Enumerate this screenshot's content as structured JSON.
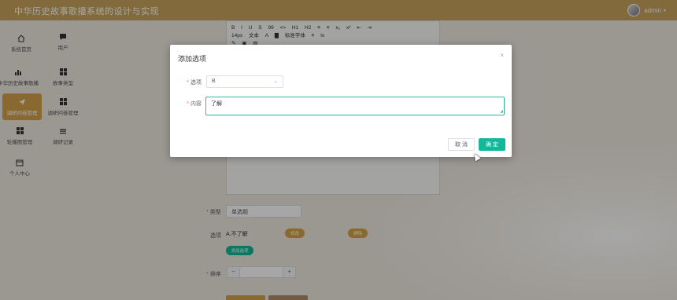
{
  "app": {
    "title": "中华历史故事歌播系统的设计与实现"
  },
  "user": {
    "name": "admin",
    "caret": "▾"
  },
  "sidebar": {
    "items": [
      {
        "label": "系统首页",
        "icon": "home-icon"
      },
      {
        "label": "用户",
        "icon": "chat-icon"
      },
      {
        "label": "中华历史故事歌播",
        "icon": "chart-icon"
      },
      {
        "label": "故事类型",
        "icon": "grid-icon"
      },
      {
        "label": "调研问卷管理",
        "icon": "send-icon",
        "active": true
      },
      {
        "label": "调研问卷管理",
        "icon": "grid-icon"
      },
      {
        "label": "轮播图管理",
        "icon": "grid-icon"
      },
      {
        "label": "调研记录",
        "icon": "list-icon"
      },
      {
        "label": "个人中心",
        "icon": "calendar-icon"
      }
    ]
  },
  "editor": {
    "toolbar_row1": [
      "B",
      "I",
      "U",
      "S",
      "99",
      "<>",
      "H1",
      "H2",
      "≡",
      "≡",
      "x₂",
      "x²",
      "⇤",
      "⇥"
    ],
    "toolbar_row2": [
      "14px",
      "文本",
      "A",
      "▇",
      "标准字体",
      "≡",
      "Ix"
    ],
    "toolbar_row3": [
      "✎",
      "▣",
      "▤"
    ]
  },
  "form": {
    "type_label": "类型",
    "type_value": "单选题",
    "options_label": "选项",
    "option_text": "A.不了解",
    "modify_label": "修改",
    "delete_label": "删除",
    "add_label": "添加选项",
    "sort_label": "排序",
    "stepper_minus": "−",
    "stepper_plus": "+"
  },
  "dialog": {
    "title": "添加选项",
    "close": "×",
    "option_label": "选项",
    "option_value": "B",
    "content_label": "内容",
    "content_value": "了解",
    "cancel": "取 消",
    "confirm": "确 定",
    "required_mark": "*"
  },
  "colors": {
    "topbar": "#c9a45c",
    "active_nav": "#d4a24c",
    "confirm": "#13b89a",
    "textarea_focus": "#2fb5a4",
    "pill_orange": "#d4a24c",
    "pill_green": "#13b89a"
  }
}
